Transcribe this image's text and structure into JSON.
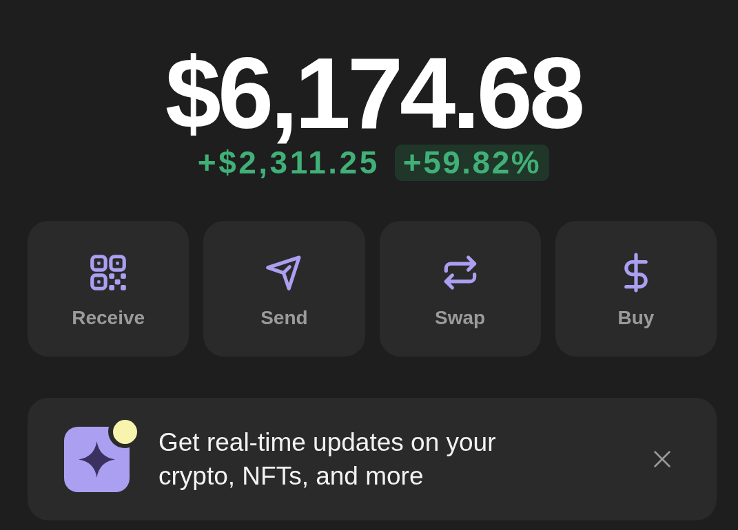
{
  "balance": {
    "amount": "$6,174.68",
    "change": "+$2,311.25",
    "change_percent": "+59.82%",
    "positive": true
  },
  "actions": [
    {
      "label": "Receive",
      "kind": "qr"
    },
    {
      "label": "Send",
      "kind": "send"
    },
    {
      "label": "Swap",
      "kind": "swap"
    },
    {
      "label": "Buy",
      "kind": "buy"
    }
  ],
  "banner": {
    "text": "Get real-time updates on your crypto, NFTs, and more",
    "new": true
  }
}
